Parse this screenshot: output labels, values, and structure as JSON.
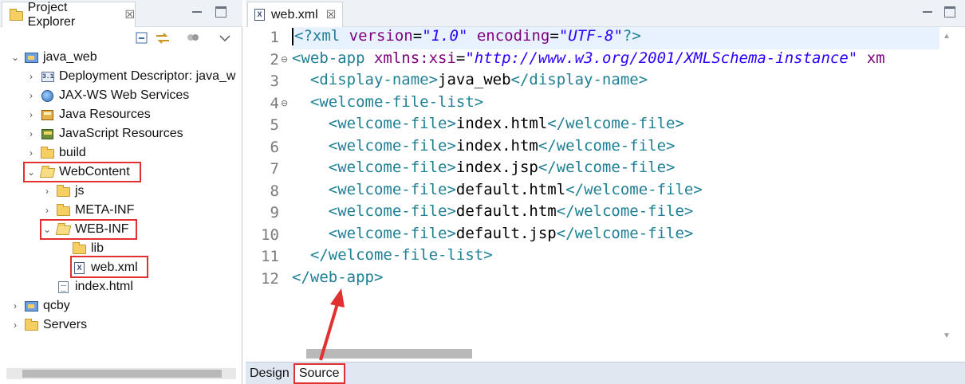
{
  "explorer": {
    "tab_label": "Project Explorer",
    "tab_close": "☒",
    "tree": [
      {
        "label": "java_web",
        "chev": "⌄",
        "icon": "java-project-icon"
      },
      {
        "label": "Deployment Descriptor: java_w",
        "chev": "›",
        "icon": "deployment-descriptor-icon"
      },
      {
        "label": "JAX-WS Web Services",
        "chev": "›",
        "icon": "web-services-globe-icon"
      },
      {
        "label": "Java Resources",
        "chev": "›",
        "icon": "java-resources-icon"
      },
      {
        "label": "JavaScript Resources",
        "chev": "›",
        "icon": "javascript-resources-icon"
      },
      {
        "label": "build",
        "chev": "›",
        "icon": "folder-icon"
      },
      {
        "label": "WebContent",
        "chev": "⌄",
        "icon": "folder-open-icon"
      },
      {
        "label": "js",
        "chev": "›",
        "icon": "folder-icon"
      },
      {
        "label": "META-INF",
        "chev": "›",
        "icon": "folder-icon"
      },
      {
        "label": "WEB-INF",
        "chev": "⌄",
        "icon": "folder-open-icon"
      },
      {
        "label": "lib",
        "chev": "",
        "icon": "folder-icon"
      },
      {
        "label": "web.xml",
        "chev": "",
        "icon": "xml-file-icon"
      },
      {
        "label": "index.html",
        "chev": "",
        "icon": "html-file-icon"
      },
      {
        "label": "qcby",
        "chev": "›",
        "icon": "java-project-icon"
      },
      {
        "label": "Servers",
        "chev": "›",
        "icon": "folder-icon"
      }
    ]
  },
  "editor": {
    "tab_label": "web.xml",
    "tab_close": "☒",
    "line_numbers": [
      "1",
      "2",
      "3",
      "4",
      "5",
      "6",
      "7",
      "8",
      "9",
      "10",
      "11",
      "12"
    ],
    "fold_marker": "⊖",
    "lines": [
      [
        {
          "c": "tagc",
          "t": "?xml "
        },
        {
          "c": "attr",
          "t": "version"
        },
        {
          "c": "txt",
          "t": "="
        },
        {
          "c": "val",
          "t": "\"1.0\""
        },
        {
          "c": "txt",
          "t": " "
        },
        {
          "c": "attr",
          "t": "encoding"
        },
        {
          "c": "txt",
          "t": "="
        },
        {
          "c": "val",
          "t": "\"UTF-8\""
        },
        {
          "c": "tagc",
          "t": "?>"
        }
      ],
      [
        {
          "c": "tagc",
          "t": "<web-app "
        },
        {
          "c": "attr",
          "t": "xmlns:xsi"
        },
        {
          "c": "txt",
          "t": "="
        },
        {
          "c": "val",
          "t": "\"http://www.w3.org/2001/XMLSchema-instance\""
        },
        {
          "c": "txt",
          "t": " "
        },
        {
          "c": "attr",
          "t": "xm"
        }
      ],
      [
        {
          "c": "tagc",
          "t": "  <display-name>"
        },
        {
          "c": "txt",
          "t": "java_web"
        },
        {
          "c": "tagc",
          "t": "</display-name>"
        }
      ],
      [
        {
          "c": "tagc",
          "t": "  <welcome-file-list>"
        }
      ],
      [
        {
          "c": "tagc",
          "t": "    <welcome-file>"
        },
        {
          "c": "txt",
          "t": "index.html"
        },
        {
          "c": "tagc",
          "t": "</welcome-file>"
        }
      ],
      [
        {
          "c": "tagc",
          "t": "    <welcome-file>"
        },
        {
          "c": "txt",
          "t": "index.htm"
        },
        {
          "c": "tagc",
          "t": "</welcome-file>"
        }
      ],
      [
        {
          "c": "tagc",
          "t": "    <welcome-file>"
        },
        {
          "c": "txt",
          "t": "index.jsp"
        },
        {
          "c": "tagc",
          "t": "</welcome-file>"
        }
      ],
      [
        {
          "c": "tagc",
          "t": "    <welcome-file>"
        },
        {
          "c": "txt",
          "t": "default.html"
        },
        {
          "c": "tagc",
          "t": "</welcome-file>"
        }
      ],
      [
        {
          "c": "tagc",
          "t": "    <welcome-file>"
        },
        {
          "c": "txt",
          "t": "default.htm"
        },
        {
          "c": "tagc",
          "t": "</welcome-file>"
        }
      ],
      [
        {
          "c": "tagc",
          "t": "    <welcome-file>"
        },
        {
          "c": "txt",
          "t": "default.jsp"
        },
        {
          "c": "tagc",
          "t": "</welcome-file>"
        }
      ],
      [
        {
          "c": "tagc",
          "t": "  </welcome-file-list>"
        }
      ],
      [
        {
          "c": "tagc",
          "t": "</web-app>"
        }
      ]
    ],
    "bottom_tabs": {
      "design": "Design",
      "source": "Source"
    }
  },
  "colors": {
    "tag": "#1f7f94",
    "attribute": "#7f007f",
    "value": "#2a00ff",
    "annotation": "#e03030"
  }
}
